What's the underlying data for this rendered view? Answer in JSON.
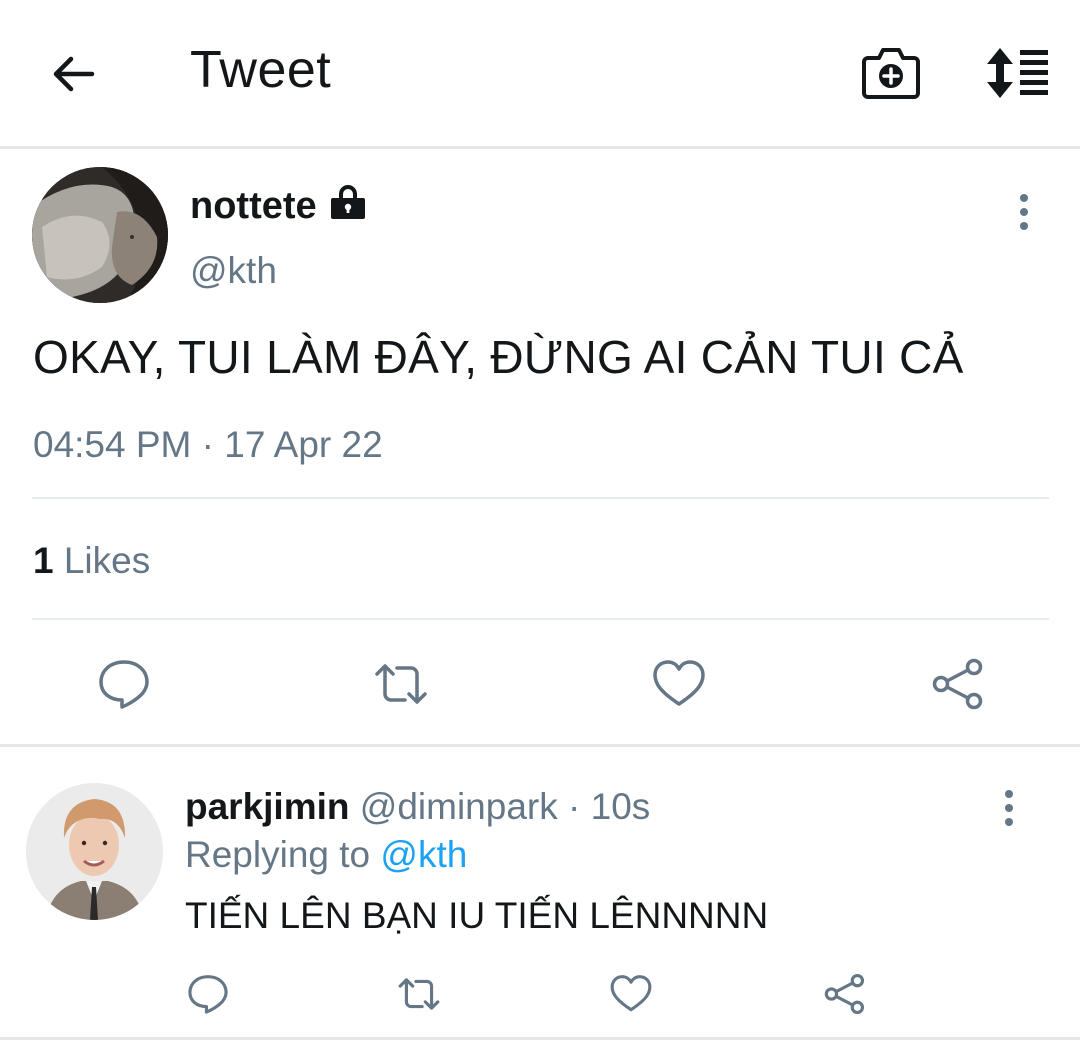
{
  "header": {
    "title": "Tweet"
  },
  "tweet": {
    "author_name": "nottete",
    "author_handle": "@kth",
    "text": "OKAY, TUI LÀM ĐÂY, ĐỪNG AI CẢN TUI CẢ",
    "time": "04:54 PM",
    "separator": "·",
    "date": "17 Apr 22",
    "likes_count": "1",
    "likes_label": "Likes"
  },
  "reply": {
    "author_name": "parkjimin",
    "author_handle": "@diminpark",
    "separator": "·",
    "time": "10s",
    "replying_prefix": "Replying to",
    "replying_mention": "@kth",
    "text": "TIẾN LÊN BẠN IU TIẾN LÊNNNNN"
  },
  "icons": {
    "back": "arrow-left-icon",
    "camera": "camera-plus-icon",
    "sort": "sort-list-icon",
    "lock": "lock-icon",
    "more": "more-vertical-icon",
    "reply": "comment-icon",
    "retweet": "retweet-icon",
    "like": "heart-icon",
    "share": "share-icon"
  },
  "colors": {
    "text_primary": "#14171a",
    "text_secondary": "#657786",
    "mention": "#1da1f2",
    "divider": "#e6ecf0"
  }
}
